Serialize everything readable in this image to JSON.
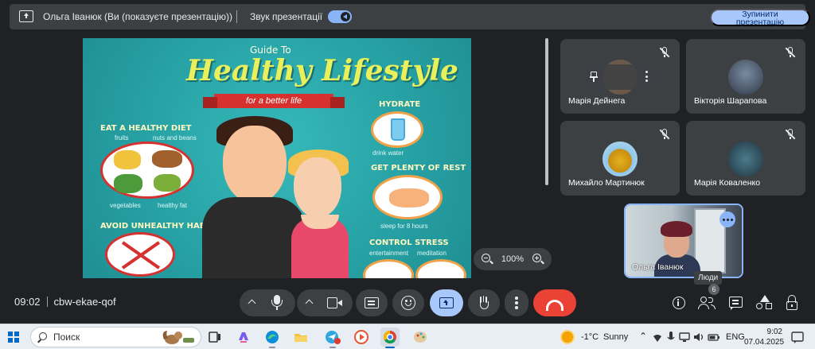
{
  "banner": {
    "title": "Ольга Іванюк (Ви (показуєте презентацію))",
    "sound_label": "Звук презентації",
    "stop_label": "Зупинити\nпрезентацію"
  },
  "slide": {
    "guide": "Guide To",
    "headline": "Healthy Lifestyle",
    "ribbon": "for a better life",
    "sections": {
      "eat": "EAT A HEALTHY DIET",
      "fruits": "fruits",
      "nuts": "nuts and beans",
      "vegetables": "vegetables",
      "fat": "healthy fat",
      "hydrate": "HYDRATE",
      "drink": "drink water",
      "rest": "GET PLENTY OF REST",
      "sleep": "sleep for 8 hours",
      "avoid": "AVOID UNHEALTHY HABITS",
      "stress": "CONTROL STRESS",
      "entertainment": "entertainment",
      "meditation": "meditation"
    }
  },
  "zoom": {
    "value": "100%"
  },
  "participants": [
    {
      "name": "Марія Дейнега",
      "avatar_color": "#6b5a4a",
      "pinned_controls": true
    },
    {
      "name": "Вікторія Шарапова",
      "avatar_color": "#4a5566"
    },
    {
      "name": "Михайло Мартинюк",
      "avatar_color": "#e0b820"
    },
    {
      "name": "Марія Коваленко",
      "avatar_color": "#2c4a5a"
    }
  ],
  "self": {
    "name": "Ольга Іванюк"
  },
  "tooltip": {
    "people": "Люди"
  },
  "people_count": "6",
  "meeting": {
    "time": "09:02",
    "code": "cbw-ekae-qof"
  },
  "taskbar": {
    "search_placeholder": "Поиск",
    "weather": "-1°C",
    "weather_text": "Sunny",
    "lang": "ENG",
    "time": "9:02",
    "date": "07.04.2025"
  },
  "colors": {
    "accent": "#8ab4f8",
    "present_active": "#a8c7fa",
    "hangup": "#ea4335",
    "tile": "#3c4043"
  }
}
